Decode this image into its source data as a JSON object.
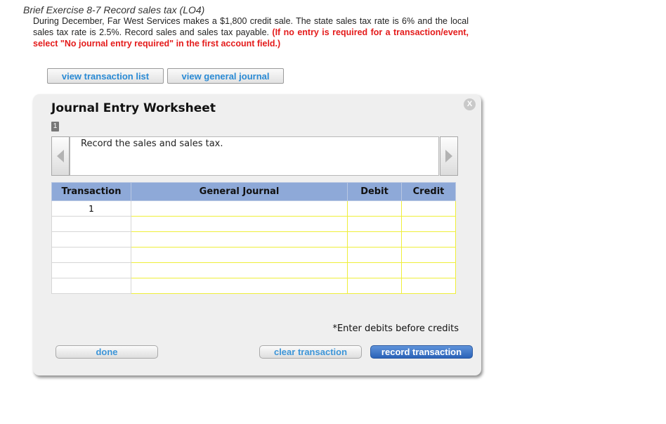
{
  "exercise": {
    "title": "Brief Exercise 8-7 Record sales tax (LO4)",
    "body": "During December, Far West Services makes a $1,800 credit sale. The state sales tax rate is 6% and the local sales tax rate is 2.5%. Record sales and sales tax payable.",
    "instruction": "(If no entry is required for a transaction/event, select \"No journal entry required\" in the first account field.)"
  },
  "buttons": {
    "view_transaction_list": "view transaction list",
    "view_general_journal": "view general journal",
    "done": "done",
    "clear_transaction": "clear transaction",
    "record_transaction": "record transaction"
  },
  "worksheet": {
    "title": "Journal Entry Worksheet",
    "close_label": "X",
    "page_number": "1",
    "instruction_text": "Record the sales and sales tax.",
    "note": "*Enter debits before credits"
  },
  "table": {
    "headers": [
      "Transaction",
      "General Journal",
      "Debit",
      "Credit"
    ],
    "rows": [
      {
        "transaction": "1"
      },
      {
        "transaction": ""
      },
      {
        "transaction": ""
      },
      {
        "transaction": ""
      },
      {
        "transaction": ""
      },
      {
        "transaction": ""
      }
    ]
  },
  "icons": {
    "prev": "chevron-left-icon",
    "next": "chevron-right-icon",
    "close": "close-icon"
  },
  "colors": {
    "header_bg": "#8ea9d8",
    "input_border": "#efef3a",
    "link_blue": "#2a8ad4",
    "primary_button": "#2a62b8",
    "instruction_red": "#e41b1b"
  }
}
